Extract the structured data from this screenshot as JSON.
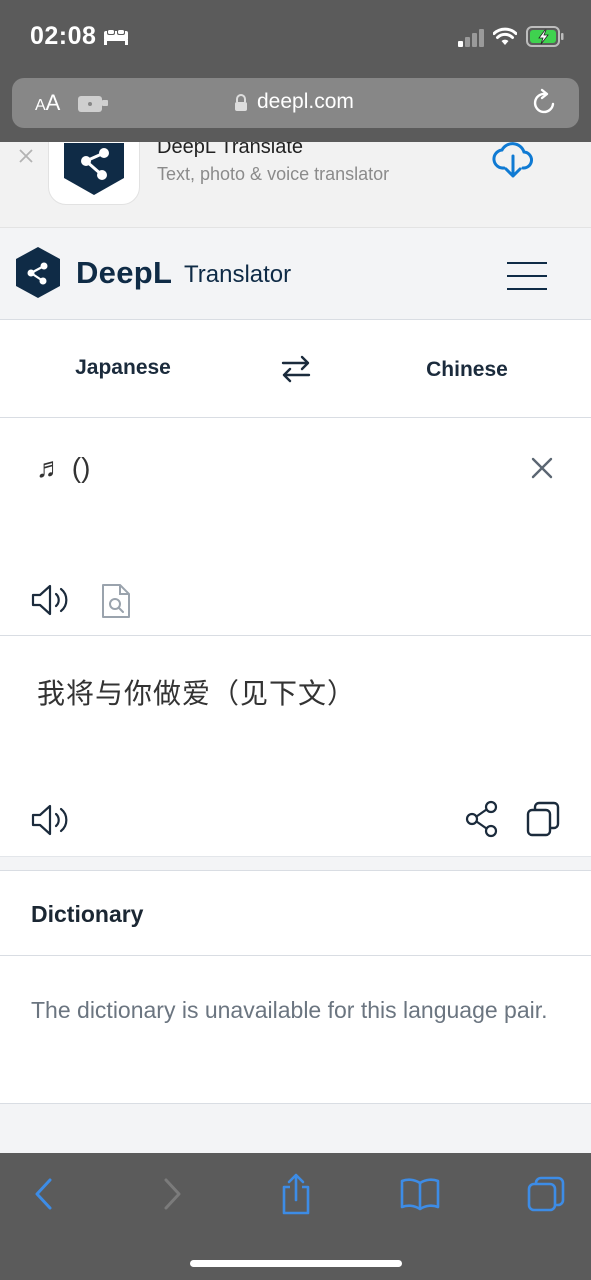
{
  "status_bar": {
    "time": "02:08"
  },
  "browser": {
    "aa_label_small": "A",
    "aa_label": "A",
    "domain": "deepl.com"
  },
  "app_banner": {
    "title": "DeepL Translate",
    "subtitle": "Text, photo & voice translator"
  },
  "header": {
    "brand": "DeepL",
    "product": "Translator"
  },
  "languages": {
    "source": "Japanese",
    "target": "Chinese"
  },
  "source": {
    "text": "♬ ()"
  },
  "target": {
    "text": "我将与你做爱（见下文）"
  },
  "dictionary": {
    "title": "Dictionary",
    "message": "The dictionary is unavailable for this language pair."
  },
  "colors": {
    "brand": "#0f2b46",
    "accent": "#0f7ad3",
    "browser_chrome": "#5b5b5b",
    "toolbar_icon": "#3d8ce6"
  }
}
